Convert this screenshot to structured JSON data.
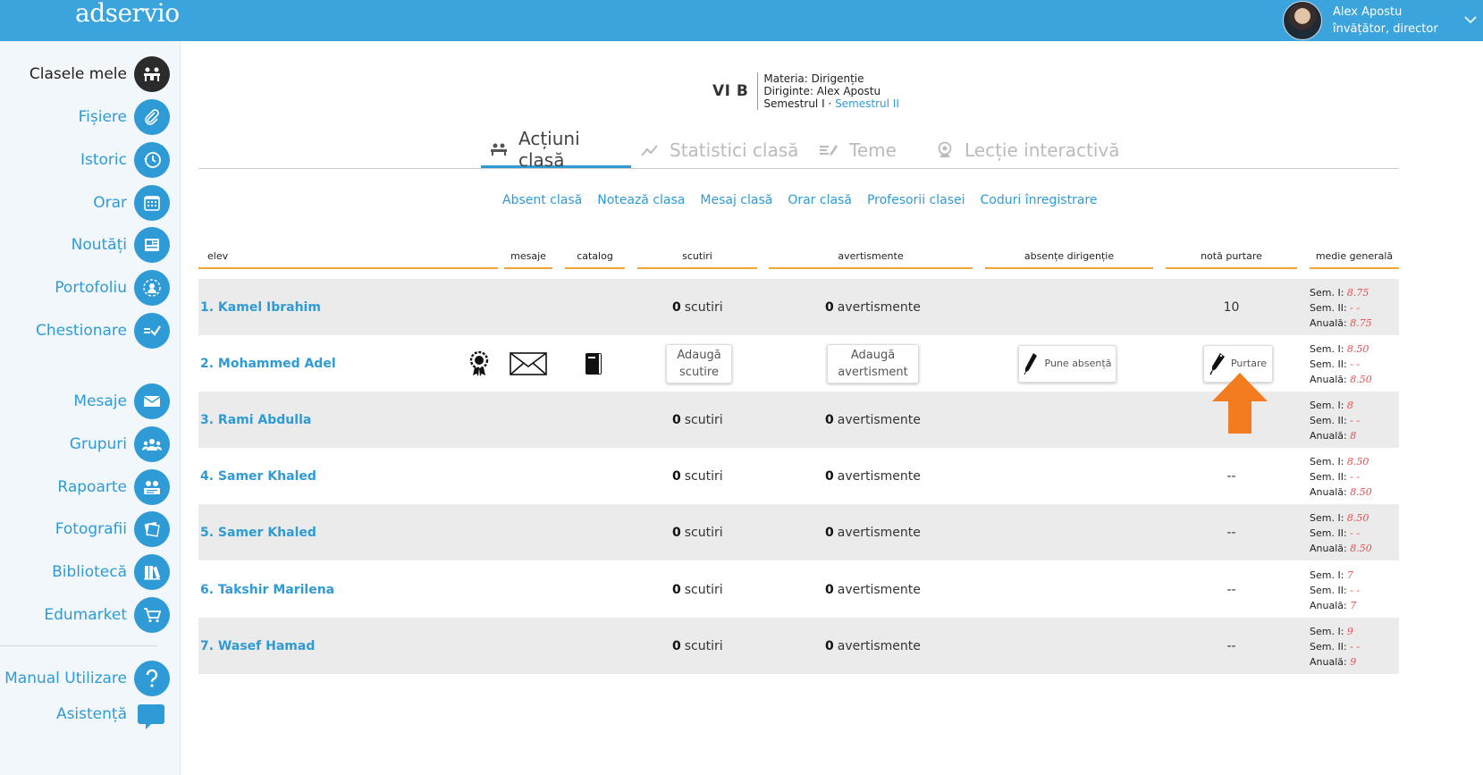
{
  "app": {
    "logo": "adservio"
  },
  "user": {
    "name": "Alex Apostu",
    "role": "învățător, director"
  },
  "sidebar": {
    "items": [
      {
        "label": "Clasele mele",
        "icon": "classroom-icon"
      },
      {
        "label": "Fișiere",
        "icon": "paperclip-icon"
      },
      {
        "label": "Istoric",
        "icon": "history-icon"
      },
      {
        "label": "Orar",
        "icon": "calendar-icon"
      },
      {
        "label": "Noutăți",
        "icon": "news-icon"
      },
      {
        "label": "Portofoliu",
        "icon": "portfolio-icon"
      },
      {
        "label": "Chestionare",
        "icon": "questionnaire-icon"
      },
      {
        "label": "Mesaje",
        "icon": "envelope-icon"
      },
      {
        "label": "Grupuri",
        "icon": "groups-icon"
      },
      {
        "label": "Rapoarte",
        "icon": "reports-icon"
      },
      {
        "label": "Fotografii",
        "icon": "photos-icon"
      },
      {
        "label": "Bibliotecă",
        "icon": "library-icon"
      },
      {
        "label": "Edumarket",
        "icon": "cart-icon"
      },
      {
        "label": "Manual Utilizare",
        "icon": "help-icon"
      },
      {
        "label": "Asistență",
        "icon": "chat-icon"
      }
    ]
  },
  "class": {
    "name": "VI B",
    "subject": "Materia: Dirigenție",
    "teacher": "Diriginte: Alex Apostu",
    "semester_prefix": "Semestrul I · ",
    "semester_link": "Semestrul II"
  },
  "tabs": [
    "Acțiuni clasă",
    "Statistici clasă",
    "Teme",
    "Lecție interactivă"
  ],
  "actions": [
    "Absent clasă",
    "Notează clasa",
    "Mesaj clasă",
    "Orar clasă",
    "Profesorii clasei",
    "Coduri înregistrare"
  ],
  "columns": [
    "elev",
    "mesaje",
    "catalog",
    "scutiri",
    "avertismente",
    "absențe dirigenție",
    "notă purtare",
    "medie generală"
  ],
  "labels": {
    "scutiri": "scutiri",
    "avertismente": "avertismente",
    "add_exemption": "Adaugă scutire",
    "add_warning": "Adaugă avertisment",
    "add_absence": "Pune absență",
    "conduct": "Purtare",
    "sem1": "Sem. I:",
    "sem2": "Sem. II:",
    "annual": "Anuală:"
  },
  "students": [
    {
      "name": "1. Kamel Ibrahim",
      "exemptions": "0",
      "warnings": "0",
      "conduct": "10",
      "sem1": "8.75",
      "sem2": "- -",
      "annual": "8.75"
    },
    {
      "name": "2. Mohammed Adel",
      "exemptions": "",
      "warnings": "",
      "conduct": "",
      "sem1": "8.50",
      "sem2": "- -",
      "annual": "8.50"
    },
    {
      "name": "3. Rami Abdulla",
      "exemptions": "0",
      "warnings": "0",
      "conduct": "",
      "sem1": "8",
      "sem2": "- -",
      "annual": "8"
    },
    {
      "name": "4. Samer Khaled",
      "exemptions": "0",
      "warnings": "0",
      "conduct": "--",
      "sem1": "8.50",
      "sem2": "- -",
      "annual": "8.50"
    },
    {
      "name": "5. Samer Khaled",
      "exemptions": "0",
      "warnings": "0",
      "conduct": "--",
      "sem1": "8.50",
      "sem2": "- -",
      "annual": "8.50"
    },
    {
      "name": "6. Takshir Marilena",
      "exemptions": "0",
      "warnings": "0",
      "conduct": "--",
      "sem1": "7",
      "sem2": "- -",
      "annual": "7"
    },
    {
      "name": "7. Wasef Hamad",
      "exemptions": "0",
      "warnings": "0",
      "conduct": "--",
      "sem1": "9",
      "sem2": "- -",
      "annual": "9"
    }
  ],
  "colors": {
    "brand": "#3ba4dd",
    "link": "#2f9bd6",
    "header_underline": "#f0a437",
    "grade": "#e94d4d",
    "arrow": "#f47c20"
  }
}
